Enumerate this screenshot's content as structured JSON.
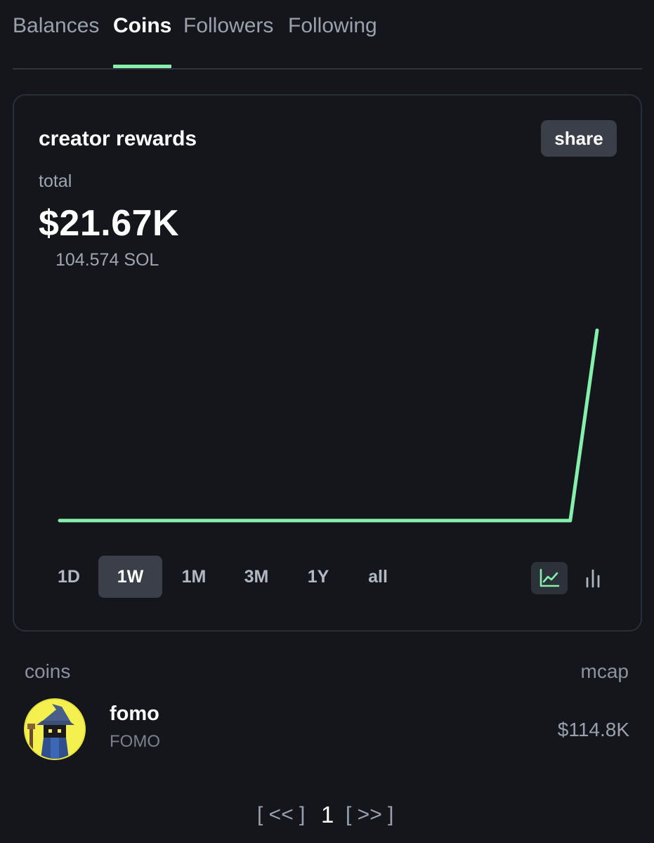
{
  "tabs": [
    {
      "label": "Balances",
      "active": false
    },
    {
      "label": "Coins",
      "active": true
    },
    {
      "label": "Followers",
      "active": false
    },
    {
      "label": "Following",
      "active": false
    }
  ],
  "card": {
    "title": "creator rewards",
    "share_label": "share",
    "total_label": "total",
    "total_value": "$21.67K",
    "total_sol": "104.574 SOL"
  },
  "chart_data": {
    "type": "line",
    "color": "#86efac",
    "x": [
      0,
      1,
      2,
      3,
      4,
      5,
      6,
      7,
      8,
      9,
      10,
      11,
      12,
      13,
      14,
      15,
      16,
      17,
      18,
      19,
      20
    ],
    "values": [
      0,
      0,
      0,
      0,
      0,
      0,
      0,
      0,
      0,
      0,
      0,
      0,
      0,
      0,
      0,
      0,
      0,
      0,
      0,
      0,
      21.67
    ],
    "ylim": [
      0,
      24
    ],
    "grid": false
  },
  "ranges": [
    {
      "label": "1D",
      "active": false
    },
    {
      "label": "1W",
      "active": true
    },
    {
      "label": "1M",
      "active": false
    },
    {
      "label": "3M",
      "active": false
    },
    {
      "label": "1Y",
      "active": false
    },
    {
      "label": "all",
      "active": false
    }
  ],
  "chart_types": [
    {
      "icon": "line-chart-icon",
      "active": true
    },
    {
      "icon": "bar-chart-icon",
      "active": false
    }
  ],
  "list": {
    "header_left": "coins",
    "header_right": "mcap",
    "coins": [
      {
        "name": "fomo",
        "symbol": "FOMO",
        "mcap": "$114.8K",
        "avatar_icon": "wizard-avatar-icon"
      }
    ]
  },
  "pagination": {
    "prev": "[ << ]",
    "page": "1",
    "next": "[ >> ]"
  }
}
